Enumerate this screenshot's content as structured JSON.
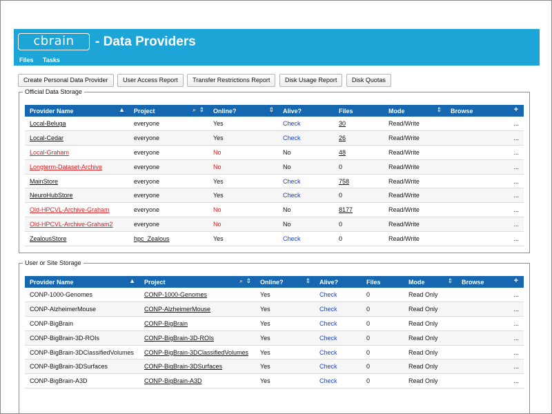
{
  "header": {
    "logo_text": "cbrain",
    "title": "- Data Providers",
    "nav": [
      "Files",
      "Tasks"
    ]
  },
  "toolbar": {
    "buttons": [
      "Create Personal Data Provider",
      "User Access Report",
      "Transfer Restrictions Report",
      "Disk Usage Report",
      "Disk Quotas"
    ]
  },
  "official": {
    "legend": "Official Data Storage",
    "columns": [
      "Provider Name",
      "Project",
      "Online?",
      "Alive?",
      "Files",
      "Mode",
      "Browse"
    ],
    "rows": [
      {
        "name": "Local-Beluga",
        "project": "everyone",
        "online": "Yes",
        "alive": "Check",
        "files": "30",
        "mode": "Read/Write",
        "browse": "...",
        "status": "ok",
        "files_link": true,
        "project_link": false
      },
      {
        "name": "Local-Cedar",
        "project": "everyone",
        "online": "Yes",
        "alive": "Check",
        "files": "26",
        "mode": "Read/Write",
        "browse": "...",
        "status": "ok",
        "files_link": true,
        "project_link": false
      },
      {
        "name": "Local-Graham",
        "project": "everyone",
        "online": "No",
        "alive": "No",
        "files": "48",
        "mode": "Read/Write",
        "browse": "...",
        "status": "offline",
        "files_link": true,
        "project_link": false
      },
      {
        "name": "Longterm-Dataset-Archive",
        "project": "everyone",
        "online": "No",
        "alive": "No",
        "files": "0",
        "mode": "Read/Write",
        "browse": "...",
        "status": "offline",
        "files_link": false,
        "project_link": false
      },
      {
        "name": "MainStore",
        "project": "everyone",
        "online": "Yes",
        "alive": "Check",
        "files": "758",
        "mode": "Read/Write",
        "browse": "...",
        "status": "ok",
        "files_link": true,
        "project_link": false
      },
      {
        "name": "NeuroHubStore",
        "project": "everyone",
        "online": "Yes",
        "alive": "Check",
        "files": "0",
        "mode": "Read/Write",
        "browse": "...",
        "status": "ok",
        "files_link": false,
        "project_link": false
      },
      {
        "name": "Old-HPCVL-Archive-Graham",
        "project": "everyone",
        "online": "No",
        "alive": "No",
        "files": "8177",
        "mode": "Read/Write",
        "browse": "...",
        "status": "offline",
        "files_link": true,
        "project_link": false
      },
      {
        "name": "Old-HPCVL-Archive-Graham2",
        "project": "everyone",
        "online": "No",
        "alive": "No",
        "files": "0",
        "mode": "Read/Write",
        "browse": "...",
        "status": "offline",
        "files_link": false,
        "project_link": false
      },
      {
        "name": "ZealousStore",
        "project": "hpc_Zealous",
        "online": "Yes",
        "alive": "Check",
        "files": "0",
        "mode": "Read/Write",
        "browse": "...",
        "status": "ok",
        "files_link": false,
        "project_link": true
      }
    ]
  },
  "user": {
    "legend": "User or Site Storage",
    "columns": [
      "Provider Name",
      "Project",
      "Online?",
      "Alive?",
      "Files",
      "Mode",
      "Browse"
    ],
    "rows": [
      {
        "name": "CONP-1000-Genomes",
        "project": "CONP-1000-Genomes",
        "online": "Yes",
        "alive": "Check",
        "files": "0",
        "mode": "Read Only",
        "browse": "..."
      },
      {
        "name": "CONP-AlzheimerMouse",
        "project": "CONP-AlzheimerMouse",
        "online": "Yes",
        "alive": "Check",
        "files": "0",
        "mode": "Read Only",
        "browse": "..."
      },
      {
        "name": "CONP-BigBrain",
        "project": "CONP-BigBrain",
        "online": "Yes",
        "alive": "Check",
        "files": "0",
        "mode": "Read Only",
        "browse": "..."
      },
      {
        "name": "CONP-BigBrain-3D-ROIs",
        "project": "CONP-BigBrain-3D-ROIs",
        "online": "Yes",
        "alive": "Check",
        "files": "0",
        "mode": "Read Only",
        "browse": "..."
      },
      {
        "name": "CONP-BigBrain-3DClassifiedVolumes",
        "project": "CONP-BigBrain-3DClassifiedVolumes",
        "online": "Yes",
        "alive": "Check",
        "files": "0",
        "mode": "Read Only",
        "browse": "..."
      },
      {
        "name": "CONP-BigBrain-3DSurfaces",
        "project": "CONP-BigBrain-3DSurfaces",
        "online": "Yes",
        "alive": "Check",
        "files": "0",
        "mode": "Read Only",
        "browse": "..."
      },
      {
        "name": "CONP-BigBrain-A3D",
        "project": "CONP-BigBrain-A3D",
        "online": "Yes",
        "alive": "Check",
        "files": "0",
        "mode": "Read Only",
        "browse": "..."
      }
    ]
  },
  "icons": {
    "sort": "sort-up-down-icon",
    "sort_up": "sort-up-icon",
    "search": "search-icon",
    "add": "plus-icon"
  },
  "colors": {
    "header_bg": "#1ea5d8",
    "table_header_bg": "#1766b0",
    "offline_red": "#d62020",
    "check_blue": "#1a3fd0"
  }
}
